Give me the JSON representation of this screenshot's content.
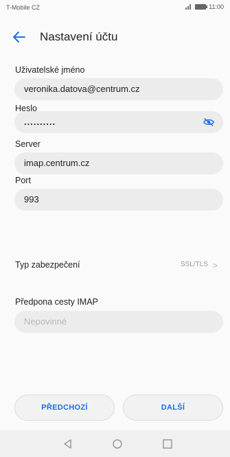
{
  "status_bar": {
    "carrier": "T-Mobile CZ",
    "time": "11:00"
  },
  "header": {
    "title": "Nastavení účtu",
    "back_icon": "back-arrow-icon"
  },
  "form": {
    "username": {
      "label": "Uživatelské jméno",
      "value": "veronika.datova@centrum.cz"
    },
    "password": {
      "label": "Heslo",
      "value": "..........",
      "toggle_icon": "eye-off-icon"
    },
    "server": {
      "label": "Server",
      "value": "imap.centrum.cz"
    },
    "port": {
      "label": "Port",
      "value": "993"
    },
    "security": {
      "label": "Typ zabezpečení",
      "value": "SSL/TLS"
    },
    "imap_prefix": {
      "label": "Předpona cesty IMAP",
      "placeholder": "Nepovinné"
    }
  },
  "buttons": {
    "previous": "PŘEDCHOZÍ",
    "next": "DALŠÍ"
  },
  "colors": {
    "accent": "#1e6ee6",
    "field_bg": "#ececec"
  }
}
